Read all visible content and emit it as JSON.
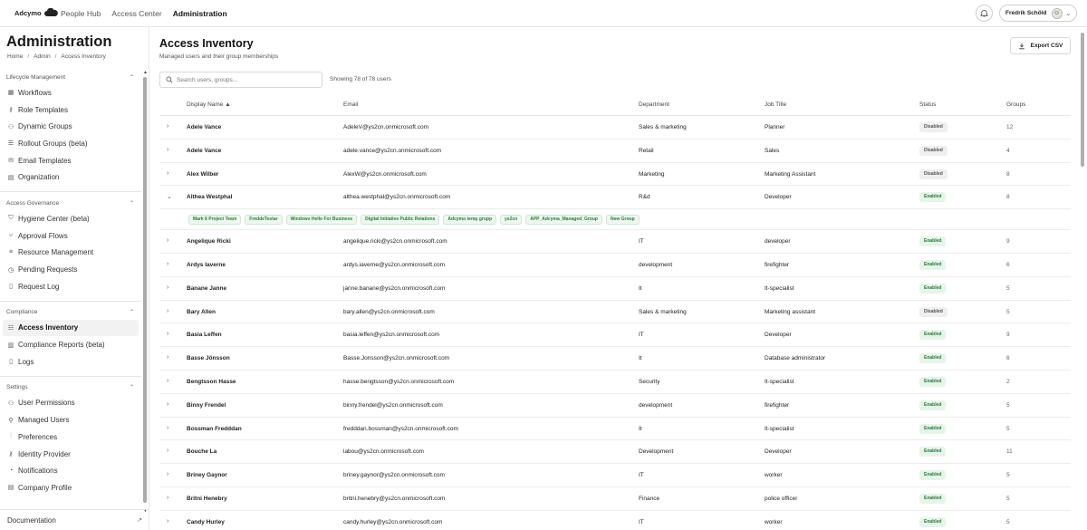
{
  "header": {
    "logo_text": "Adcymo",
    "nav": [
      {
        "label": "People Hub",
        "active": false
      },
      {
        "label": "Access Center",
        "active": false
      },
      {
        "label": "Administration",
        "active": true
      }
    ],
    "user_name": "Fredrik Schöld"
  },
  "sidebar": {
    "title": "Administration",
    "breadcrumb": [
      "Home",
      "Admin",
      "Access Inventory"
    ],
    "sections": [
      {
        "label": "Lifecycle Management",
        "items": [
          {
            "label": "Workflows",
            "icon": "grid-icon"
          },
          {
            "label": "Role Templates",
            "icon": "key-icon"
          },
          {
            "label": "Dynamic Groups",
            "icon": "users-icon"
          },
          {
            "label": "Rollout Groups (beta)",
            "icon": "layers-icon"
          },
          {
            "label": "Email Templates",
            "icon": "mail-icon"
          },
          {
            "label": "Organization",
            "icon": "building-icon"
          }
        ]
      },
      {
        "label": "Access Governance",
        "items": [
          {
            "label": "Hygiene Center (beta)",
            "icon": "shield-icon"
          },
          {
            "label": "Approval Flows",
            "icon": "branch-icon"
          },
          {
            "label": "Resource Management",
            "icon": "database-icon"
          },
          {
            "label": "Pending Requests",
            "icon": "clock-icon"
          },
          {
            "label": "Request Log",
            "icon": "document-icon"
          }
        ]
      },
      {
        "label": "Compliance",
        "items": [
          {
            "label": "Access Inventory",
            "icon": "list-icon",
            "active": true
          },
          {
            "label": "Compliance Reports (beta)",
            "icon": "report-icon"
          },
          {
            "label": "Logs",
            "icon": "document-icon"
          }
        ]
      },
      {
        "label": "Settings",
        "items": [
          {
            "label": "User Permissions",
            "icon": "users-icon"
          },
          {
            "label": "Managed Users",
            "icon": "user-icon"
          },
          {
            "label": "Preferences",
            "icon": "sliders-icon"
          },
          {
            "label": "Identity Provider",
            "icon": "key-icon"
          },
          {
            "label": "Notifications",
            "icon": "bell-icon"
          },
          {
            "label": "Company Profile",
            "icon": "building-icon"
          }
        ]
      }
    ],
    "footer_label": "Documentation"
  },
  "main": {
    "title": "Access Inventory",
    "subtitle": "Managed users and their group memberships",
    "export_label": "Export CSV",
    "search_placeholder": "Search users, groups...",
    "count_text": "Showing 78 of 78 users",
    "columns": [
      "Display Name ▲",
      "Email",
      "Department",
      "Job Title",
      "Status",
      "Groups"
    ],
    "rows": [
      {
        "name": "Adele Vance",
        "email": "AdeleV@ys2cn.onmicrosoft.com",
        "department": "Sales & marketing",
        "job": "Planner",
        "status": "Disabled",
        "groups": "12"
      },
      {
        "name": "Adele Vance",
        "email": "adele.vance@ys2cn.onmicrosoft.com",
        "department": "Retail",
        "job": "Sales",
        "status": "Disabled",
        "groups": "4"
      },
      {
        "name": "Alex Wilber",
        "email": "AlexW@ys2cn.onmicrosoft.com",
        "department": "Marketing",
        "job": "Marketing Assistant",
        "status": "Disabled",
        "groups": "8"
      },
      {
        "name": "Althea Westphal",
        "email": "althea.westphal@ys2cn.onmicrosoft.com",
        "department": "R&d",
        "job": "Developer",
        "status": "Enabled",
        "groups": "8",
        "expanded": true,
        "group_chips": [
          "Mark 8 Project Team",
          "FreddeTestar",
          "Windows Hello For Business",
          "Digital Initiative Public Relations",
          "Adcymo temp grupp",
          "ys2cn",
          "APP_Adcyma_Managed_Group",
          "New Group"
        ]
      },
      {
        "name": "Angelique Ricki",
        "email": "angelique.ricki@ys2cn.onmicrosoft.com",
        "department": "IT",
        "job": "developer",
        "status": "Enabled",
        "groups": "9"
      },
      {
        "name": "Ardys Iaverne",
        "email": "ardys.iaverne@ys2cn.onmicrosoft.com",
        "department": "development",
        "job": "firefighter",
        "status": "Enabled",
        "groups": "6"
      },
      {
        "name": "Banane Janne",
        "email": "janne.banane@ys2cn.onmicrosoft.com",
        "department": "It",
        "job": "It-specialist",
        "status": "Enabled",
        "groups": "5"
      },
      {
        "name": "Bary Allen",
        "email": "bary.allen@ys2cn.onmicrosoft.com",
        "department": "Sales & marketing",
        "job": "Marketing assistant",
        "status": "Disabled",
        "groups": "5"
      },
      {
        "name": "Basia Leffen",
        "email": "basia.leffen@ys2cn.onmicrosoft.com",
        "department": "IT",
        "job": "Developer",
        "status": "Enabled",
        "groups": "9"
      },
      {
        "name": "Basse Jönsson",
        "email": "Basse.Jonsson@ys2cn.onmicrosoft.com",
        "department": "It",
        "job": "Database administrator",
        "status": "Enabled",
        "groups": "6"
      },
      {
        "name": "Bengtsson Hasse",
        "email": "hasse.bengtsson@ys2cn.onmicrosoft.com",
        "department": "Security",
        "job": "It-specialist",
        "status": "Enabled",
        "groups": "2"
      },
      {
        "name": "Binny Frendel",
        "email": "binny.frendel@ys2cn.onmicrosoft.com",
        "department": "development",
        "job": "firefighter",
        "status": "Enabled",
        "groups": "5"
      },
      {
        "name": "Bossman Fredddan",
        "email": "fredddan.bossman@ys2cn.onmicrosoft.com",
        "department": "It",
        "job": "It-specialist",
        "status": "Enabled",
        "groups": "5"
      },
      {
        "name": "Bouche La",
        "email": "labou@ys2cn.onmicrosoft.com",
        "department": "Development",
        "job": "Developer",
        "status": "Enabled",
        "groups": "11"
      },
      {
        "name": "Briney Gaynor",
        "email": "briney.gaynor@ys2cn.onmicrosoft.com",
        "department": "IT",
        "job": "worker",
        "status": "Enabled",
        "groups": "5"
      },
      {
        "name": "Britni Henebry",
        "email": "britni.henebry@ys2cn.onmicrosoft.com",
        "department": "Finance",
        "job": "police officer",
        "status": "Enabled",
        "groups": "5"
      },
      {
        "name": "Candy Hurley",
        "email": "candy.hurley@ys2cn.onmicrosoft.com",
        "department": "IT",
        "job": "worker",
        "status": "Enabled",
        "groups": "5"
      }
    ]
  },
  "colors": {
    "enabled_bg": "#e6f4e9",
    "enabled_text": "#2a7a3b",
    "disabled_bg": "#efefef"
  }
}
